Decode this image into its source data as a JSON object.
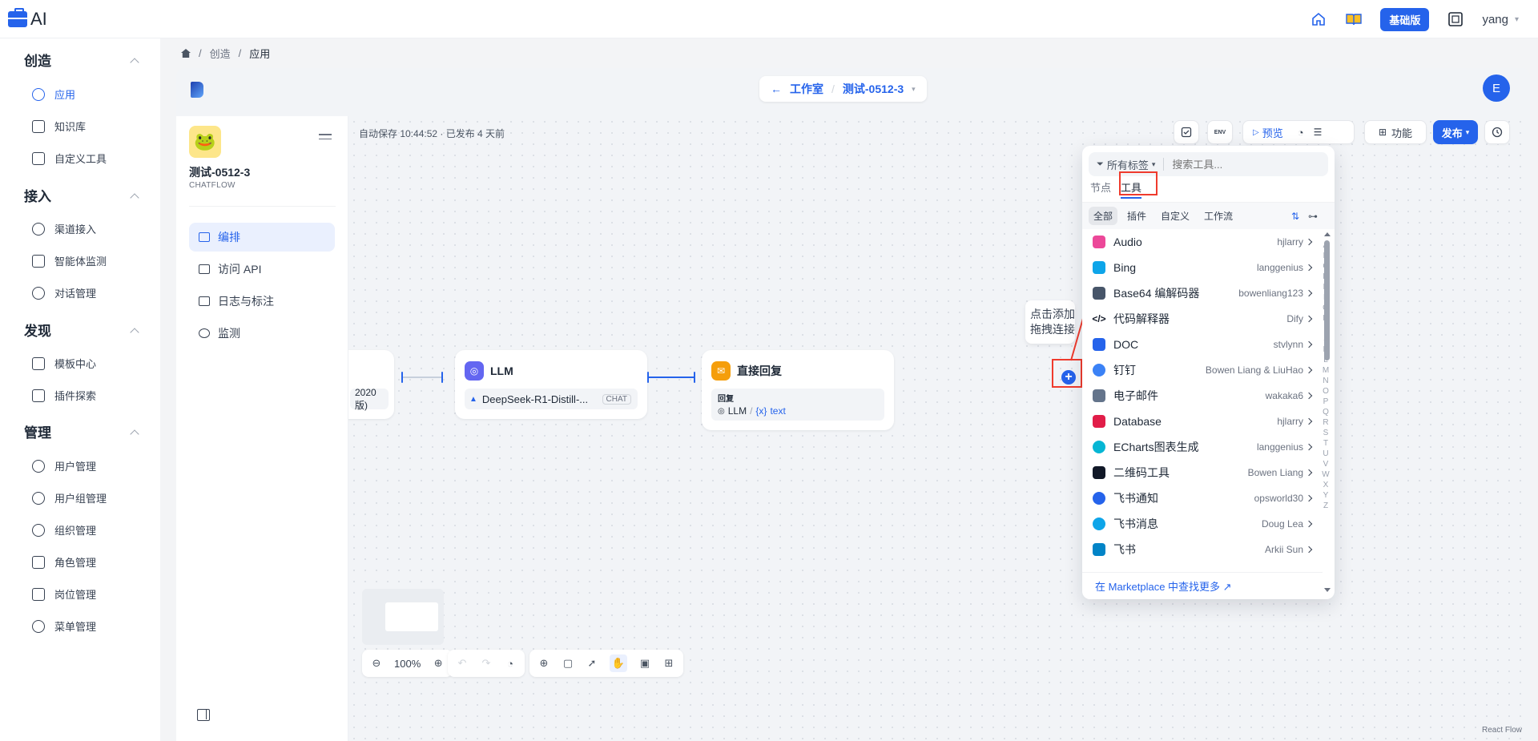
{
  "brand": {
    "logo_text": "AI"
  },
  "topbar": {
    "plan_badge": "基础版",
    "user_name": "yang"
  },
  "sidebar": {
    "sections": [
      {
        "title": "创造",
        "items": [
          "应用",
          "知识库",
          "自定义工具"
        ]
      },
      {
        "title": "接入",
        "items": [
          "渠道接入",
          "智能体监测",
          "对话管理"
        ]
      },
      {
        "title": "发现",
        "items": [
          "模板中心",
          "插件探索"
        ]
      },
      {
        "title": "管理",
        "items": [
          "用户管理",
          "用户组管理",
          "组织管理",
          "角色管理",
          "岗位管理",
          "菜单管理"
        ]
      }
    ],
    "active_item": "应用"
  },
  "breadcrumb": {
    "items": [
      "创造",
      "应用"
    ]
  },
  "header": {
    "studio": "工作室",
    "app_name": "测试-0512-3",
    "avatar_letter": "E"
  },
  "app": {
    "name": "测试-0512-3",
    "type": "CHATFLOW",
    "nav": [
      "编排",
      "访问 API",
      "日志与标注",
      "监测"
    ],
    "active_nav": "编排"
  },
  "canvas": {
    "autosave": "自动保存 10:44:52 · 已发布 4 天前",
    "toolbar": {
      "preview": "预览",
      "features": "功能",
      "publish": "发布",
      "env": "ENV"
    },
    "nodes": {
      "start_partial": "2020版)",
      "llm": {
        "title": "LLM",
        "model": "DeepSeek-R1-Distill-...",
        "mode": "CHAT"
      },
      "answer": {
        "title": "直接回复",
        "field_label": "回复",
        "source": "LLM",
        "var": "text",
        "var_prefix": "{x}"
      }
    },
    "tooltip": {
      "line1": "点击添加",
      "line2": "拖拽连接"
    },
    "zoom": "100%",
    "attribution": "React Flow"
  },
  "tool_picker": {
    "tag_filter": "所有标签",
    "search_placeholder": "搜索工具...",
    "tabs": [
      "节点",
      "工具"
    ],
    "active_tab": "工具",
    "subtabs": [
      "全部",
      "插件",
      "自定义",
      "工作流"
    ],
    "active_subtab": "全部",
    "tools": [
      {
        "name": "Audio",
        "author": "hjlarry",
        "color": "#ec4899"
      },
      {
        "name": "Bing",
        "author": "langgenius",
        "color": "#0ea5e9"
      },
      {
        "name": "Base64 编解码器",
        "author": "bowenliang123",
        "color": "#475569"
      },
      {
        "name": "代码解释器",
        "author": "Dify",
        "color": "#111827"
      },
      {
        "name": "DOC",
        "author": "stvlynn",
        "color": "#2563eb"
      },
      {
        "name": "钉钉",
        "author": "Bowen Liang & LiuHao",
        "color": "#3b82f6"
      },
      {
        "name": "电子邮件",
        "author": "wakaka6",
        "color": "#64748b"
      },
      {
        "name": "Database",
        "author": "hjlarry",
        "color": "#e11d48"
      },
      {
        "name": "ECharts图表生成",
        "author": "langgenius",
        "color": "#06b6d4"
      },
      {
        "name": "二维码工具",
        "author": "Bowen Liang",
        "color": "#111827"
      },
      {
        "name": "飞书通知",
        "author": "opsworld30",
        "color": "#2563eb"
      },
      {
        "name": "飞书消息",
        "author": "Doug Lea",
        "color": "#0ea5e9"
      },
      {
        "name": "飞书",
        "author": "Arkii Sun",
        "color": "#0284c7"
      }
    ],
    "alphabet": [
      "A",
      "B",
      "C",
      "D",
      "E",
      "F",
      "G",
      "H",
      "I",
      "J",
      "K",
      "L",
      "M",
      "N",
      "O",
      "P",
      "Q",
      "R",
      "S",
      "T",
      "U",
      "V",
      "W",
      "X",
      "Y",
      "Z"
    ],
    "marketplace_link": "在 Marketplace 中查找更多 ↗"
  },
  "colors": {
    "accent": "#2563eb",
    "highlight": "#ef3b2d"
  }
}
